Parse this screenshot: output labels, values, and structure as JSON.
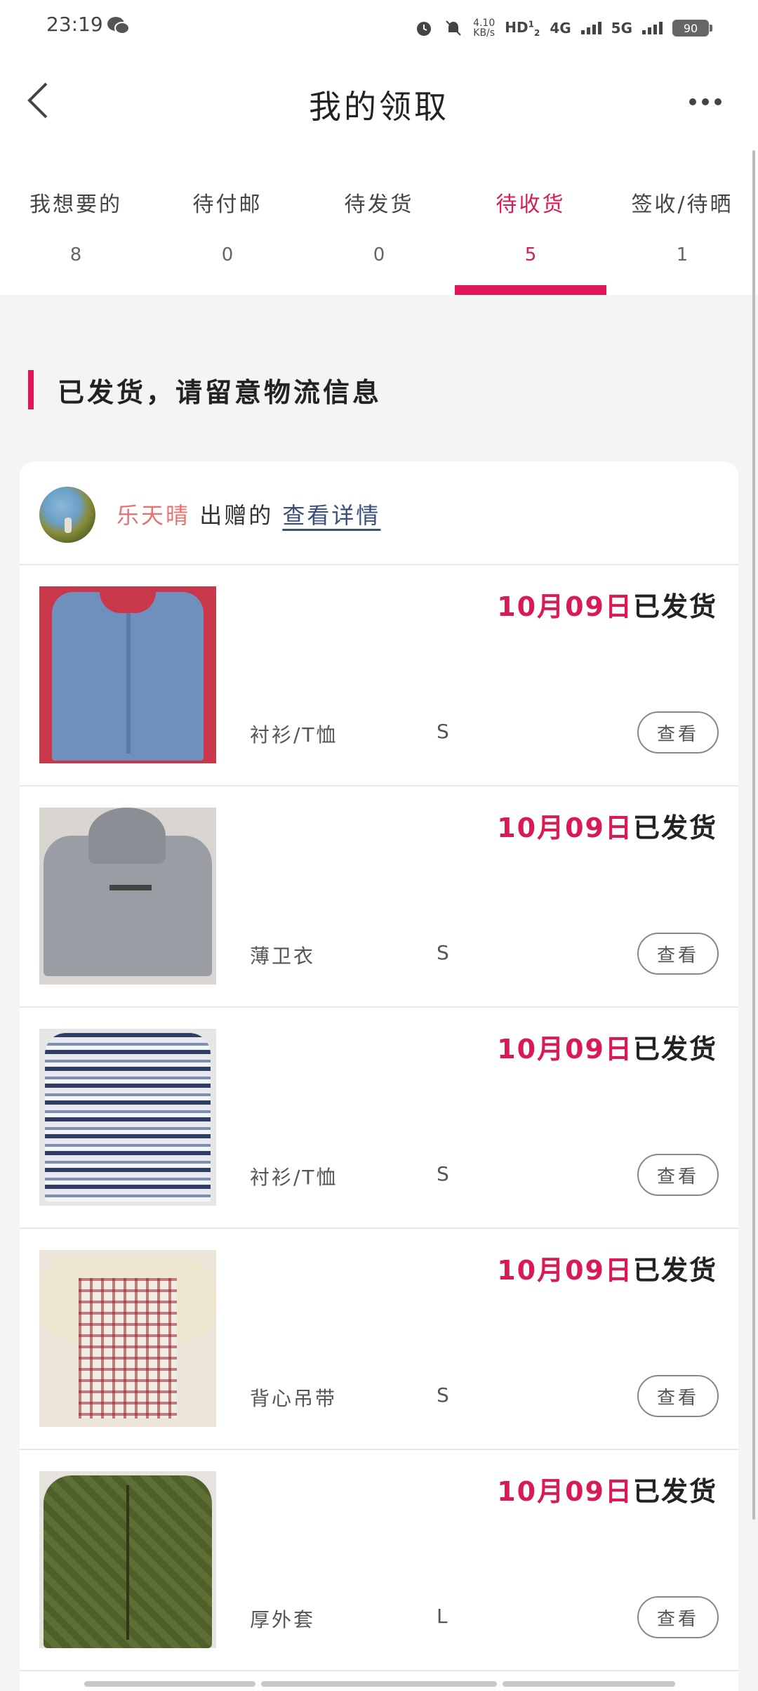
{
  "status_bar": {
    "time": "23:19",
    "network_speed": "4.10",
    "network_speed_unit": "KB/s",
    "hd_label": "HD",
    "sim_1": "1",
    "sim_2": "2",
    "net_4g": "4G",
    "net_5g": "5G",
    "battery": "90"
  },
  "header": {
    "title": "我的领取"
  },
  "tabs": [
    {
      "label": "我想要的",
      "count": "8"
    },
    {
      "label": "待付邮",
      "count": "0"
    },
    {
      "label": "待发货",
      "count": "0"
    },
    {
      "label": "待收货",
      "count": "5"
    },
    {
      "label": "签收/待晒",
      "count": "1"
    }
  ],
  "active_tab": "待收货",
  "section": {
    "title": "已发货，请留意物流信息"
  },
  "card": {
    "donor_name": "乐天晴",
    "donor_suffix": "出赠的",
    "details_link": "查看详情",
    "items": [
      {
        "date": "10月09日",
        "status": "已发货",
        "name": "衬衫/T恤",
        "size": "S",
        "button": "查看"
      },
      {
        "date": "10月09日",
        "status": "已发货",
        "name": "薄卫衣",
        "size": "S",
        "button": "查看"
      },
      {
        "date": "10月09日",
        "status": "已发货",
        "name": "衬衫/T恤",
        "size": "S",
        "button": "查看"
      },
      {
        "date": "10月09日",
        "status": "已发货",
        "name": "背心吊带",
        "size": "S",
        "button": "查看"
      },
      {
        "date": "10月09日",
        "status": "已发货",
        "name": "厚外套",
        "size": "L",
        "button": "查看"
      }
    ]
  },
  "colors": {
    "accent": "#e0185a",
    "donor": "#e57373",
    "link": "#3a4f7a"
  }
}
